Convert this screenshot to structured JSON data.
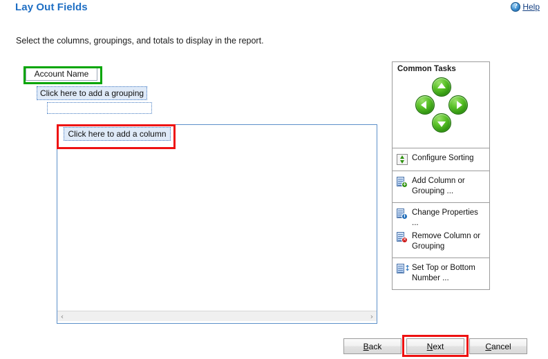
{
  "header": {
    "title": "Lay Out Fields",
    "help_label": "Help",
    "help_accel": "H",
    "help_icon": "question-circle-icon"
  },
  "instruction": "Select the columns, groupings, and totals to display in the report.",
  "design_surface": {
    "account_name_field": "Account Name",
    "grouping_placeholder": "Click here to add a grouping",
    "empty_row": "",
    "column_placeholder": "Click here to add a column",
    "scrollbar": {
      "left_arrow": "‹",
      "right_arrow": "›"
    },
    "highlights": {
      "account_name_color": "#00A500",
      "column_color": "#EE1111"
    }
  },
  "common_tasks": {
    "title": "Common Tasks",
    "nav_arrows": [
      {
        "name": "move-up",
        "glyph": "up"
      },
      {
        "name": "move-left",
        "glyph": "left"
      },
      {
        "name": "move-right",
        "glyph": "right"
      },
      {
        "name": "move-down",
        "glyph": "down"
      }
    ],
    "groups": [
      {
        "items": [
          {
            "label": "Configure Sorting",
            "icon": "sort-icon"
          }
        ]
      },
      {
        "items": [
          {
            "label": "Add Column or Grouping ...",
            "icon": "add-column-icon"
          }
        ]
      },
      {
        "items": [
          {
            "label": "Change Properties ...",
            "icon": "properties-icon"
          },
          {
            "label": "Remove Column or Grouping",
            "icon": "remove-column-icon"
          }
        ]
      },
      {
        "items": [
          {
            "label": "Set Top or Bottom Number ...",
            "icon": "top-bottom-icon"
          }
        ]
      }
    ]
  },
  "footer": {
    "back_label": "Back",
    "back_accel": "B",
    "next_label": "Next",
    "next_accel": "N",
    "cancel_label": "Cancel",
    "cancel_accel": "C",
    "next_highlight_color": "#EE1111"
  }
}
